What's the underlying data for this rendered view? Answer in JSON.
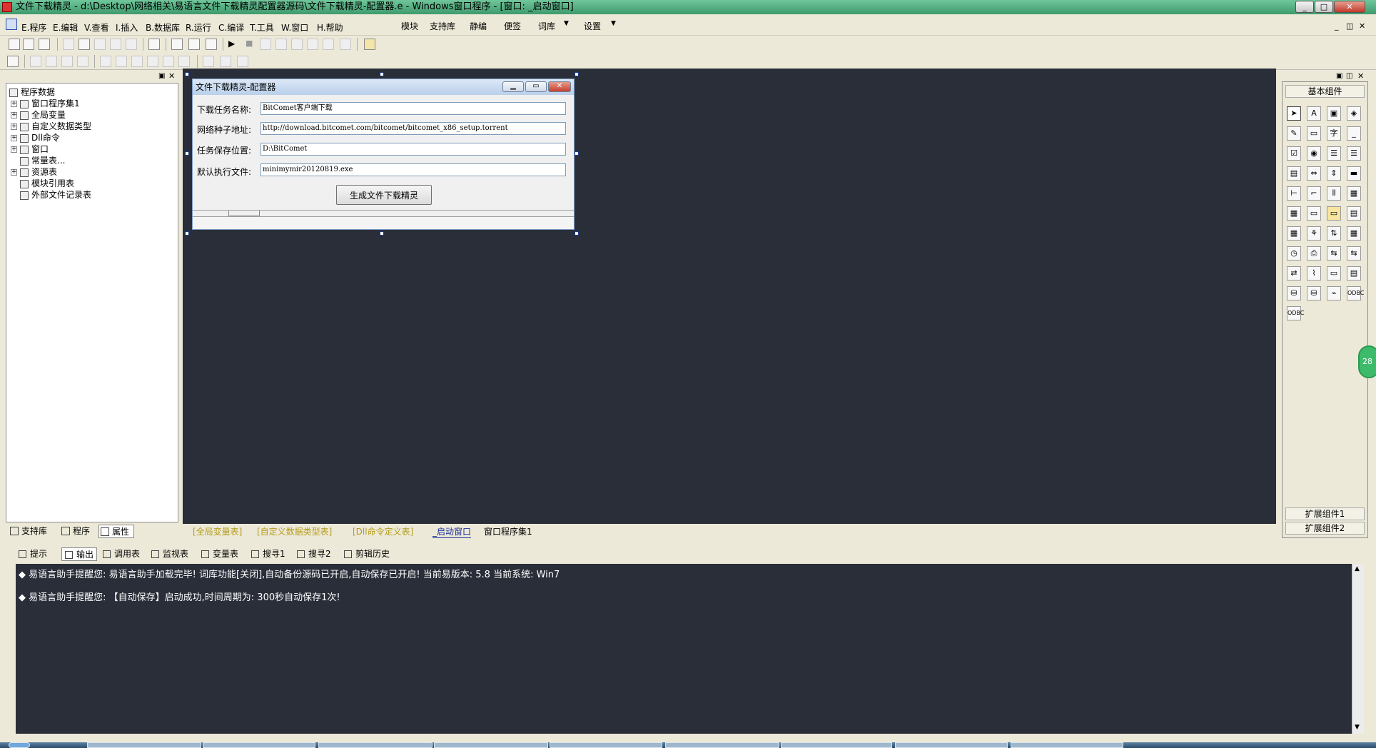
{
  "window": {
    "title": "文件下载精灵 - d:\\Desktop\\网络相关\\易语言文件下载精灵配置器源码\\文件下载精灵-配置器.e - Windows窗口程序 - [窗口: _启动窗口]"
  },
  "menu": {
    "left": [
      "E.程序",
      "E.编辑",
      "V.查看",
      "I.插入",
      "B.数据库",
      "R.运行",
      "C.编译",
      "T.工具",
      "W.窗口",
      "H.帮助"
    ],
    "right": [
      "模块",
      "支持库",
      "静编",
      "便签",
      "词库",
      "设置"
    ]
  },
  "left_panel": {
    "tree": [
      {
        "label": "程序数据",
        "icon": "root-icon"
      },
      {
        "label": "窗口程序集1",
        "icon": "module-icon"
      },
      {
        "label": "全局变量",
        "icon": "variable-icon"
      },
      {
        "label": "自定义数据类型",
        "icon": "datatype-icon"
      },
      {
        "label": "Dll命令",
        "icon": "dll-icon"
      },
      {
        "label": "窗口",
        "icon": "window-icon"
      },
      {
        "label": "常量表...",
        "icon": "const-icon"
      },
      {
        "label": "资源表",
        "icon": "resource-icon"
      },
      {
        "label": "模块引用表",
        "icon": "module-ref-icon"
      },
      {
        "label": "外部文件记录表",
        "icon": "file-record-icon"
      }
    ],
    "tabs": [
      "支持库",
      "程序",
      "属性"
    ]
  },
  "form": {
    "title": "文件下载精灵-配置器",
    "fields": [
      {
        "label": "下载任务名称:",
        "value": "BitComet客户端下载"
      },
      {
        "label": "网络种子地址:",
        "value": "http://download.bitcomet.com/bitcomet/bitcomet_x86_setup.torrent"
      },
      {
        "label": "任务保存位置:",
        "value": "D:\\BitComet"
      },
      {
        "label": "默认执行文件:",
        "value": "minimymir20120819.exe"
      }
    ],
    "button": "生成文件下载精灵"
  },
  "design_tabs": [
    "[全局变量表]",
    "[自定义数据类型表]",
    "[Dll命令定义表]",
    "_启动窗口",
    "窗口程序集1"
  ],
  "right_panel": {
    "title": "基本组件",
    "buttons": [
      "扩展组件1",
      "扩展组件2"
    ]
  },
  "bottom_tabs": [
    "提示",
    "输出",
    "调用表",
    "监视表",
    "变量表",
    "搜寻1",
    "搜寻2",
    "剪辑历史"
  ],
  "output": {
    "lines": [
      "易语言助手提醒您:  易语言助手加载完毕!  词库功能[关闭],自动备份源码已开启,自动保存已开启!  当前易版本: 5.8  当前系统: Win7",
      "易语言助手提醒您: 【自动保存】启动成功,时间周期为: 300秒自动保存1次!"
    ]
  },
  "bubble": {
    "text": "28"
  }
}
